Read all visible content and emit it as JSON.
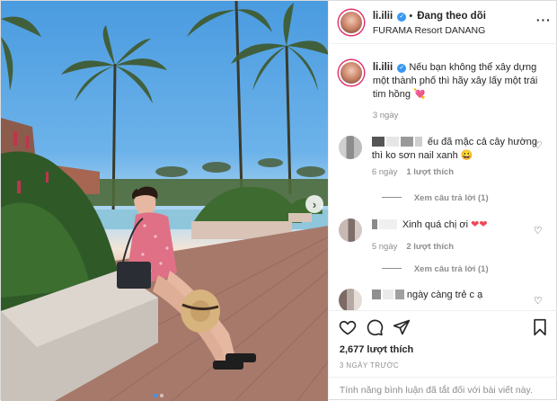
{
  "header": {
    "username": "li.ilii",
    "following_label": "Đang theo dõi",
    "location": "FURAMA Resort DANANG"
  },
  "caption": {
    "username": "li.ilii",
    "text": "Nếu bạn không thể xây dựng một thành phố thì hãy xây lấy một trái tim hồng",
    "emoji": "💘",
    "time": "3 ngày"
  },
  "comments": [
    {
      "text": "ếu đã mặc cả cây hường thì ko sơn nail xanh",
      "emoji": "😀",
      "time": "6 ngày",
      "likes": "1 lượt thích",
      "replies": "Xem câu trả lời (1)"
    },
    {
      "text": "Xinh quá chị ơi",
      "emoji": "❤❤",
      "time": "5 ngày",
      "likes": "2 lượt thích",
      "replies": "Xem câu trả lời (1)"
    },
    {
      "text": "ngày càng trẻ c ạ"
    }
  ],
  "actions": {
    "likes_count": "2,677 lượt thích",
    "date": "3 NGÀY TRƯỚC",
    "comments_disabled": "Tính năng bình luận đã tắt đối với bài viết này."
  },
  "carousel": {
    "slides": 2,
    "active": 1
  },
  "icons": {
    "next": "chevron-right-icon",
    "more": "more-options-icon",
    "like": "heart-outline-icon",
    "comment": "comment-bubble-icon",
    "share": "send-icon",
    "save": "bookmark-icon",
    "verified": "verified-badge-icon",
    "comment_like": "small-heart-icon"
  },
  "colors": {
    "accent": "#3897f0",
    "text": "#262626",
    "muted": "#8e8e8e",
    "heart": "#ed4956"
  }
}
